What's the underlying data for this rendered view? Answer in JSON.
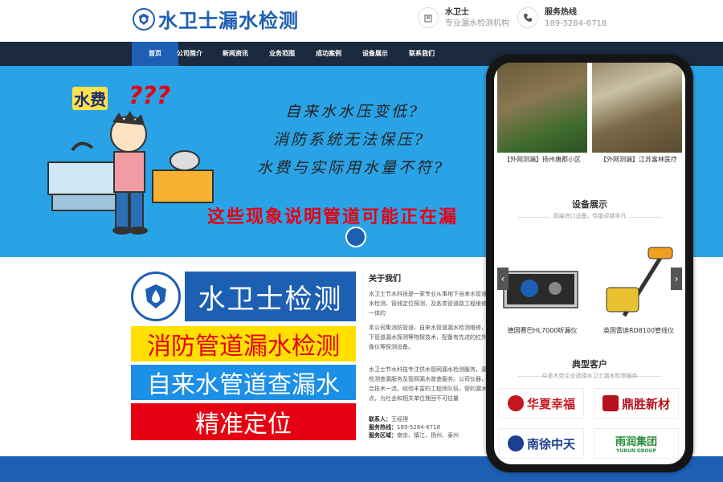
{
  "header": {
    "logo_text": "水卫士漏水检测",
    "info_1_title": "水卫士",
    "info_1_sub": "专业漏水检测机构",
    "info_2_title": "服务热线",
    "info_2_sub": "189-5284-6718"
  },
  "nav": {
    "items": [
      "首页",
      "公司简介",
      "新闻资讯",
      "业务范围",
      "成功案例",
      "设备展示",
      "联系我们"
    ]
  },
  "banner": {
    "tag": "水费",
    "qmarks": "???",
    "line1": "自来水水压变低?",
    "line2": "消防系统无法保压?",
    "line3": "水费与实际用水量不符?",
    "red_text": "这些现象说明管道可能正在漏"
  },
  "promo": {
    "line1": "水卫士检测",
    "line2": "消防管道漏水检测",
    "line3": "自来水管道查漏水",
    "line4": "精准定位"
  },
  "about": {
    "title": "关于我们",
    "p1": "水卫士节水科技是一家专业从事地下自来水管道漏水检测、管线定位探测，及各类管道路工程维修为一体的",
    "p2": "本公司集消防管道、自来水管道漏水检测维修，地下管道漏水探测等物探技术，配备有先进的红外热像仪等探测设备。",
    "p3": "水卫士节水科技专注供水管网漏水检测服务，漏水检测查漏服务及管网漏水普查服务。公司仪器，配合技术一流，经验丰富的工程师队伍，管的漏水点，为社会和相关单位挽回不可估量"
  },
  "contact": {
    "person_label": "联系人：",
    "person": "王经理",
    "phone_label": "服务热线：",
    "phone": "189-5284-6718",
    "area_label": "服务区域：",
    "area": "南京、镇江、扬州、泰州"
  },
  "phone": {
    "case_1": "【外网测漏】扬州唐郡小区",
    "case_2": "【外网测漏】江苏富林医疗",
    "equip_title": "设备展示",
    "equip_sub": "高端进口设备，性能卓越非凡",
    "prod_1": "德国赛巴HL7000听漏仪",
    "prod_2": "英国雷迪RD8100管线仪",
    "clients_title": "典型客户",
    "clients_sub": "众多大型企业选择水卫士漏水检测服务",
    "client_1": "华夏幸福",
    "client_2": "鼎胜新材",
    "client_3": "南徐中天",
    "client_4": "雨润集团",
    "client_4_en": "YURUN GROUP",
    "arrow_left": "‹",
    "arrow_right": "›"
  },
  "colors": {
    "brand_blue": "#1d5fb3",
    "nav_dark": "#1b2a3f",
    "banner_sky": "#2aa3e6",
    "accent_red": "#e60012",
    "accent_yellow": "#ffe000"
  }
}
